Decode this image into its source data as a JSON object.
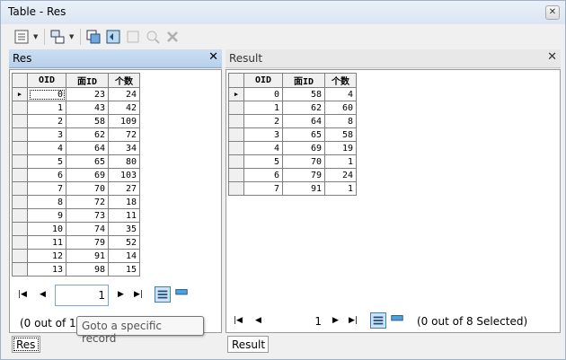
{
  "window": {
    "title": "Table - Res"
  },
  "panes": {
    "left": {
      "title": "Res",
      "columns": [
        "OID",
        "面ID",
        "个数"
      ],
      "rows": [
        [
          "0",
          "23",
          "24"
        ],
        [
          "1",
          "43",
          "42"
        ],
        [
          "2",
          "58",
          "109"
        ],
        [
          "3",
          "62",
          "72"
        ],
        [
          "4",
          "64",
          "34"
        ],
        [
          "5",
          "65",
          "80"
        ],
        [
          "6",
          "69",
          "103"
        ],
        [
          "7",
          "70",
          "27"
        ],
        [
          "8",
          "72",
          "18"
        ],
        [
          "9",
          "73",
          "11"
        ],
        [
          "10",
          "74",
          "35"
        ],
        [
          "11",
          "79",
          "52"
        ],
        [
          "12",
          "91",
          "14"
        ],
        [
          "13",
          "98",
          "15"
        ]
      ],
      "record_value": "1",
      "status": "(0 out of 14",
      "tab_label": "Res"
    },
    "right": {
      "title": "Result",
      "columns": [
        "OID",
        "面ID",
        "个数"
      ],
      "rows": [
        [
          "0",
          "58",
          "4"
        ],
        [
          "1",
          "62",
          "60"
        ],
        [
          "2",
          "64",
          "8"
        ],
        [
          "3",
          "65",
          "58"
        ],
        [
          "4",
          "69",
          "19"
        ],
        [
          "5",
          "70",
          "1"
        ],
        [
          "6",
          "79",
          "24"
        ],
        [
          "7",
          "91",
          "1"
        ]
      ],
      "record_value": "1",
      "status": "(0 out of 8 Selected)",
      "tab_label": "Result"
    }
  },
  "tooltip": {
    "text": "Goto a specific record"
  }
}
